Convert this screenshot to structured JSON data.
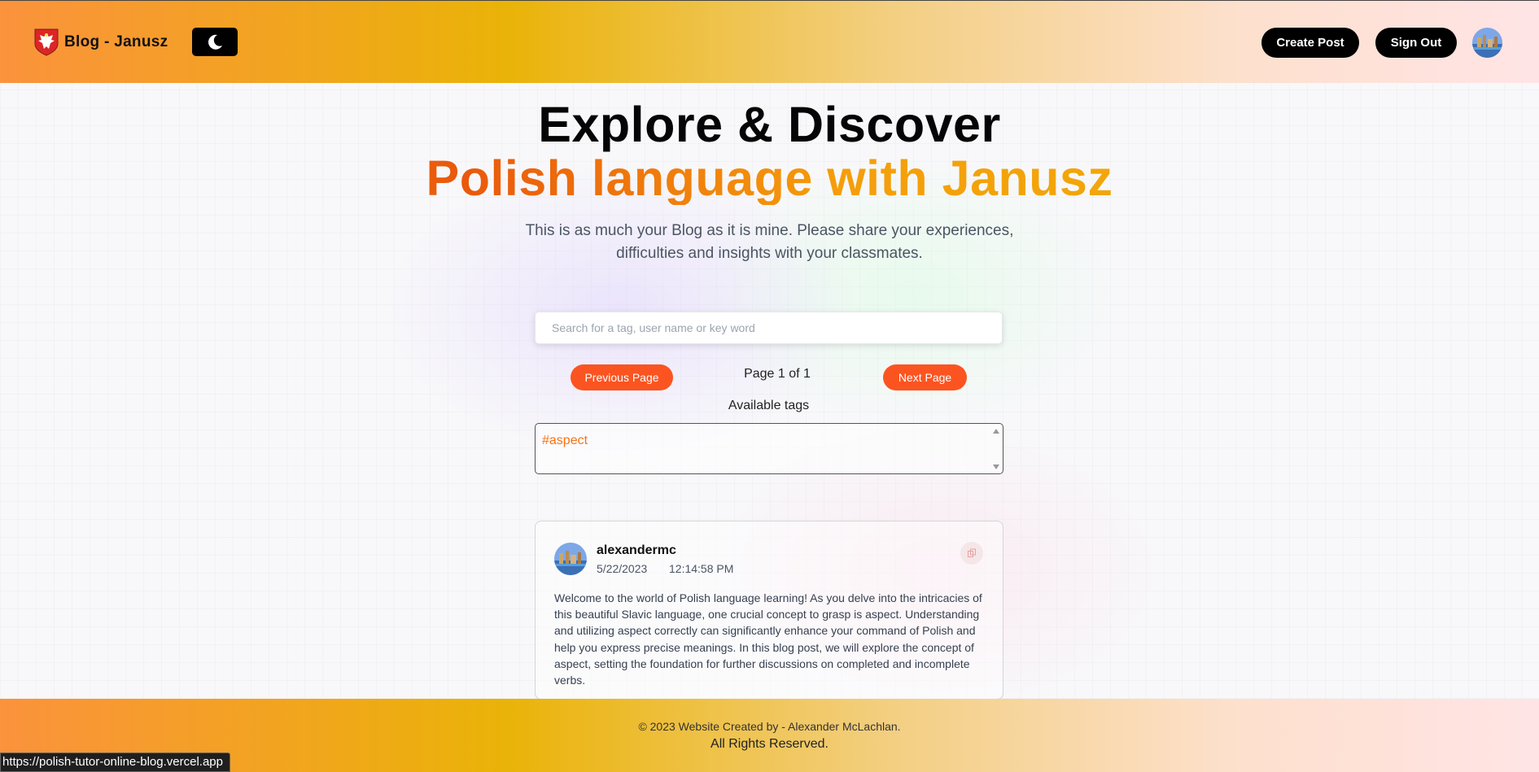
{
  "header": {
    "brand": "Blog - Janusz",
    "logo_icon": "polish-eagle-icon",
    "theme_toggle_icon": "moon-icon",
    "create_post": "Create Post",
    "sign_out": "Sign Out",
    "avatar_icon": "user-avatar"
  },
  "hero": {
    "title_line1": "Explore & Discover",
    "title_line2": "Polish language with Janusz",
    "subtitle": "This is as much your Blog as it is mine. Please share your experiences, difficulties and insights with your classmates."
  },
  "search": {
    "placeholder": "Search for a tag, user name or key word",
    "value": ""
  },
  "pagination": {
    "previous": "Previous Page",
    "indicator": "Page 1 of 1",
    "next": "Next Page"
  },
  "tags": {
    "label": "Available tags",
    "items": [
      "#aspect"
    ]
  },
  "post": {
    "username": "alexandermc",
    "date": "5/22/2023",
    "time": "12:14:58 PM",
    "copy_icon": "copy-icon",
    "body": "Welcome to the world of Polish language learning! As you delve into the intricacies of this beautiful Slavic language, one crucial concept to grasp is aspect. Understanding and utilizing aspect correctly can significantly enhance your command of Polish and help you express precise meanings. In this blog post, we will explore the concept of aspect, setting the foundation for further discussions on completed and incomplete verbs."
  },
  "footer": {
    "line1": "© 2023 Website Created by - Alexander McLachlan.",
    "line2": "All Rights Reserved."
  },
  "status_bar": {
    "url": "https://polish-tutor-online-blog.vercel.app"
  },
  "colors": {
    "accent_orange": "#fb5421",
    "tag_orange": "#f97316",
    "header_gradient_start": "#fb923c",
    "header_gradient_mid": "#eab308",
    "header_gradient_end": "#ffe4e6"
  }
}
